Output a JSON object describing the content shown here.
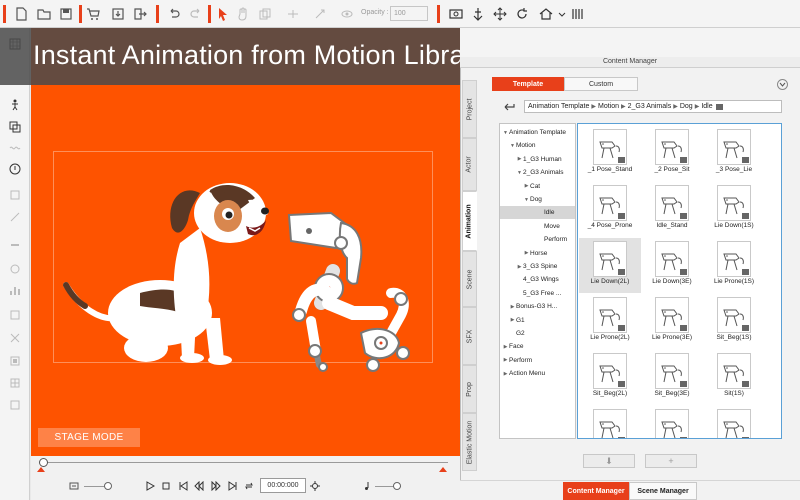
{
  "toolbar": {
    "opacity_label": "Opacity :",
    "opacity_value": "100"
  },
  "banner": {
    "text": "Instant Animation from Motion Library"
  },
  "stage": {
    "mode_label": "STAGE MODE"
  },
  "timeline": {
    "timecode": "00:00:000"
  },
  "content_manager": {
    "title": "Content Manager",
    "side_tabs": [
      "Project",
      "Actor",
      "Animation",
      "Scene",
      "SFX",
      "Prop",
      "Elastic Motion"
    ],
    "active_side_tab": "Animation",
    "tabs": {
      "template": "Template",
      "custom": "Custom"
    },
    "breadcrumb": [
      "Animation Template",
      "Motion",
      "2_G3 Animals",
      "Dog",
      "Idle"
    ],
    "tree": [
      {
        "label": "Animation Template",
        "caret": "▼"
      },
      {
        "label": "Motion",
        "caret": "▼"
      },
      {
        "label": "1_G3 Human",
        "caret": "▶"
      },
      {
        "label": "2_G3 Animals",
        "caret": "▼"
      },
      {
        "label": "Cat",
        "caret": "▶"
      },
      {
        "label": "Dog",
        "caret": "▼"
      },
      {
        "label": "Idle",
        "caret": ""
      },
      {
        "label": "Move",
        "caret": ""
      },
      {
        "label": "Perform",
        "caret": ""
      },
      {
        "label": "Horse",
        "caret": "▶"
      },
      {
        "label": "3_G3 Spine",
        "caret": "▶"
      },
      {
        "label": "4_G3 Wings",
        "caret": ""
      },
      {
        "label": "5_G3 Free ...",
        "caret": ""
      },
      {
        "label": "Bonus-G3 H...",
        "caret": "▶"
      },
      {
        "label": "G1",
        "caret": "▶"
      },
      {
        "label": "G2",
        "caret": ""
      },
      {
        "label": "Face",
        "caret": "▶"
      },
      {
        "label": "Perform",
        "caret": "▶"
      },
      {
        "label": "Action Menu",
        "caret": "▶"
      }
    ],
    "selected_tree_item": "Idle",
    "items": [
      "_1 Pose_Stand",
      "_2 Pose_Sit",
      "_3 Pose_Lie",
      "_4 Pose_Prone",
      "Idle_Stand",
      "Lie Down(1S)",
      "Lie Down(2L)",
      "Lie Down(3E)",
      "Lie Prone(1S)",
      "Lie Prone(2L)",
      "Lie Prone(3E)",
      "Sit_Beg(1S)",
      "Sit_Beg(2L)",
      "Sit_Beg(3E)",
      "Sit(1S)",
      "",
      "",
      ""
    ],
    "selected_item": "Lie Down(2L)",
    "footer": {
      "down": "⬇",
      "add": "+"
    }
  },
  "bottom_tabs": {
    "content_manager": "Content Manager",
    "scene_manager": "Scene Manager"
  },
  "colors": {
    "accent": "#e8401a",
    "stage": "#fe5300",
    "banner": "#4b4b4b"
  }
}
